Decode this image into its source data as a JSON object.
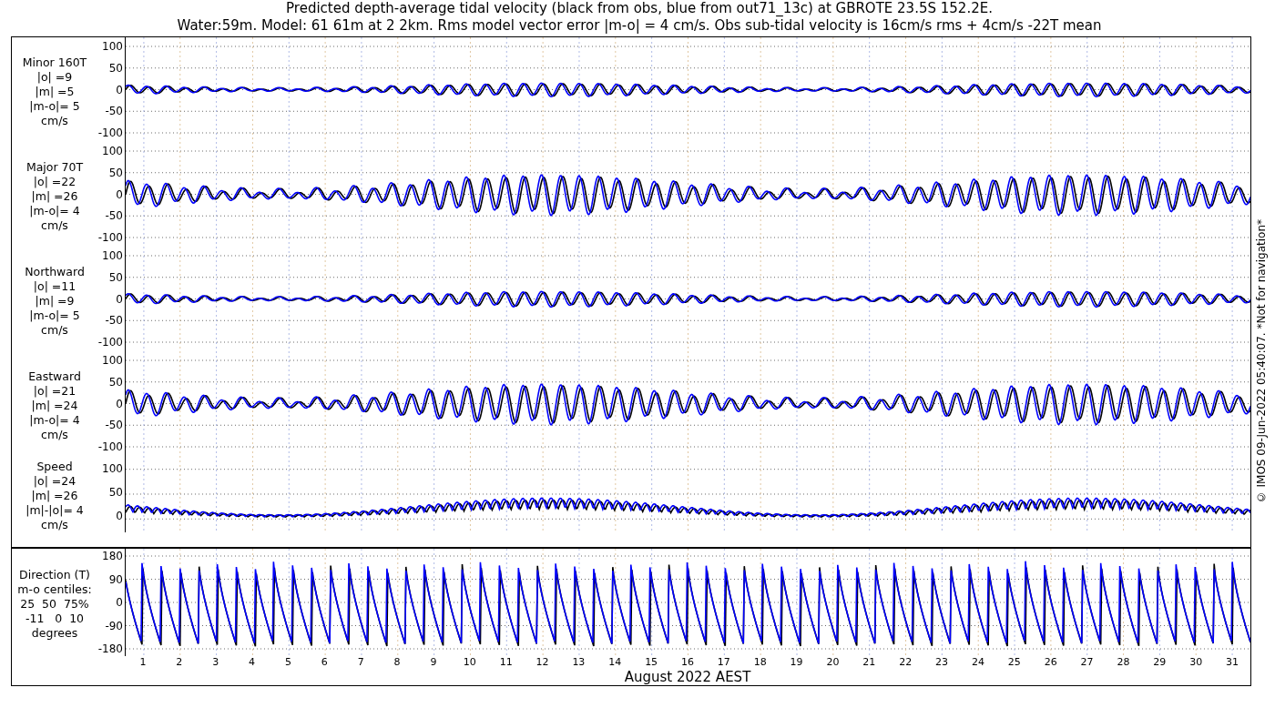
{
  "title": [
    "Predicted depth-average tidal velocity (black from obs, blue from out71_13c) at GBROTE 23.5S 152.2E.",
    "Water:59m. Model: 61 61m at 2 2km. Rms model vector error |m-o| = 4 cm/s. Obs sub-tidal velocity is 16cm/s rms + 4cm/s -22T mean"
  ],
  "panels": [
    {
      "kind": "minor",
      "label": [
        "Minor 160T",
        "|o| =9",
        "|m| =5",
        "|m-o|= 5",
        "cm/s"
      ],
      "yticks": [
        "100",
        "50",
        "0",
        "-50",
        "-100"
      ]
    },
    {
      "kind": "major",
      "label": [
        "Major 70T",
        "|o| =22",
        "|m| =26",
        "|m-o|= 4",
        "cm/s"
      ],
      "yticks": [
        "100",
        "50",
        "0",
        "-50",
        "-100"
      ]
    },
    {
      "kind": "northward",
      "label": [
        "Northward",
        "|o| =11",
        "|m| =9",
        "|m-o|= 5",
        "cm/s"
      ],
      "yticks": [
        "100",
        "50",
        "0",
        "-50",
        "-100"
      ]
    },
    {
      "kind": "eastward",
      "label": [
        "Eastward",
        "|o| =21",
        "|m| =24",
        "|m-o|= 4",
        "cm/s"
      ],
      "yticks": [
        "100",
        "50",
        "0",
        "-50",
        "-100"
      ]
    },
    {
      "kind": "speed",
      "label": [
        "Speed",
        "|o| =24",
        "|m| =26",
        "|m|-|o|= 4",
        "cm/s"
      ],
      "yticks": [
        "100",
        "50",
        "0"
      ]
    },
    {
      "kind": "direction",
      "label": [
        "Direction (T)",
        "m-o centiles:",
        "25  50  75%",
        "-11   0  10",
        "degrees"
      ],
      "yticks": [
        "180",
        "90",
        "0",
        "-90",
        "-180"
      ]
    }
  ],
  "days": [
    "1",
    "2",
    "3",
    "4",
    "5",
    "6",
    "7",
    "8",
    "9",
    "10",
    "11",
    "12",
    "13",
    "14",
    "15",
    "16",
    "17",
    "18",
    "19",
    "20",
    "21",
    "22",
    "23",
    "24",
    "25",
    "26",
    "27",
    "28",
    "29",
    "30",
    "31"
  ],
  "xlabel": "August 2022 AEST",
  "credit": "© IMOS 09-Jun-2022 05:40:07. *Not for navigation*"
}
